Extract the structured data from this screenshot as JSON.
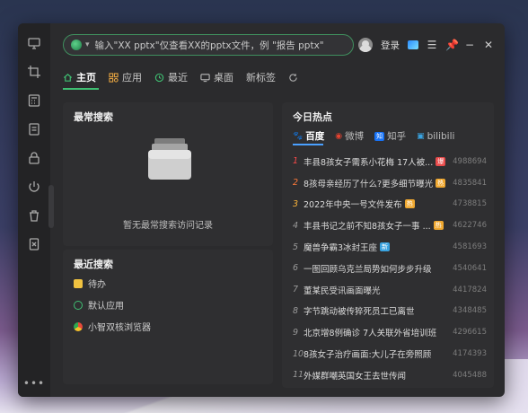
{
  "search": {
    "placeholder": "输入\"XX  pptx\"仅查看XX的pptx文件，例 \"报告 pptx\""
  },
  "topbar": {
    "login_label": "登录"
  },
  "tabs": [
    {
      "label": "主页",
      "icon": "home-icon"
    },
    {
      "label": "应用",
      "icon": "apps-icon"
    },
    {
      "label": "最近",
      "icon": "clock-icon"
    },
    {
      "label": "桌面",
      "icon": "monitor-icon"
    },
    {
      "label": "新标签",
      "icon": ""
    }
  ],
  "frequent": {
    "title": "最常搜索",
    "empty_text": "暂无最常搜索访问记录"
  },
  "recent": {
    "title": "最近搜索",
    "items": [
      {
        "label": "待办",
        "icon": "todo-icon"
      },
      {
        "label": "默认应用",
        "icon": "settings-icon"
      },
      {
        "label": "小智双核浏览器",
        "icon": "browser-icon"
      }
    ]
  },
  "hot": {
    "title": "今日热点",
    "tabs": [
      {
        "label": "百度",
        "icon": "baidu-icon"
      },
      {
        "label": "微博",
        "icon": "weibo-icon"
      },
      {
        "label": "知乎",
        "icon": "zhihu-icon"
      },
      {
        "label": "bilibili",
        "icon": "bilibili-icon"
      }
    ],
    "items": [
      {
        "rank": "1",
        "title": "丰县8孩女子需系小花梅 17人被...",
        "badge": "爆",
        "count": "4988694"
      },
      {
        "rank": "2",
        "title": "8孩母亲经历了什么?更多细节曝光",
        "badge": "热",
        "count": "4835841"
      },
      {
        "rank": "3",
        "title": "2022年中央一号文件发布",
        "badge": "热",
        "count": "4738815"
      },
      {
        "rank": "4",
        "title": "丰县书记之前不知8孩女子一事 ...",
        "badge": "热",
        "count": "4622746"
      },
      {
        "rank": "5",
        "title": "魔兽争霸3冰封王座",
        "badge": "新",
        "count": "4581693"
      },
      {
        "rank": "6",
        "title": "一图回顾乌克兰局势如何步步升级",
        "badge": "",
        "count": "4540641"
      },
      {
        "rank": "7",
        "title": "董某民受讯画面曝光",
        "badge": "",
        "count": "4417824"
      },
      {
        "rank": "8",
        "title": "字节跳动被传猝死员工已离世",
        "badge": "",
        "count": "4348485"
      },
      {
        "rank": "9",
        "title": "北京增8例确诊 7人关联外省培训班",
        "badge": "",
        "count": "4296615"
      },
      {
        "rank": "10",
        "title": "8孩女子治疗画面:大儿子在旁照顾",
        "badge": "",
        "count": "4174393"
      },
      {
        "rank": "11",
        "title": "外媒群嘲英国女王去世传闻",
        "badge": "",
        "count": "4045488"
      }
    ]
  }
}
